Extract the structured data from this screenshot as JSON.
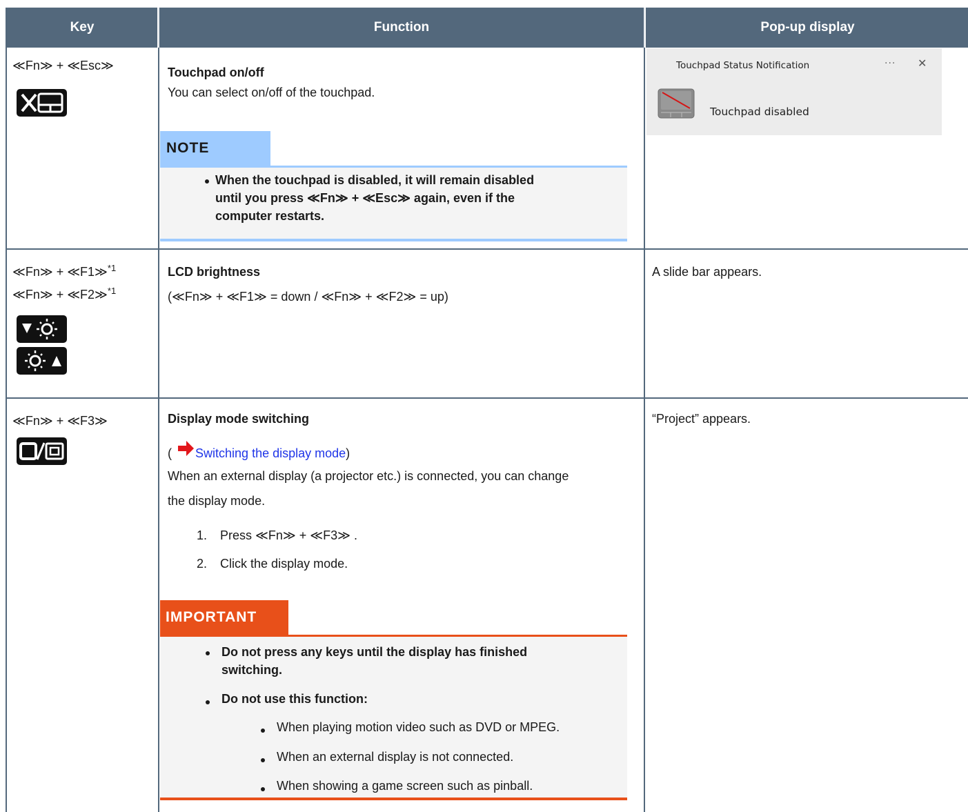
{
  "header": {
    "key": "Key",
    "function": "Function",
    "popup": "Pop-up display"
  },
  "row1": {
    "key": "≪Fn≫ + ≪Esc≫",
    "icon": "touchpad-off-icon",
    "title": "Touchpad on/off",
    "desc": "You can select on/off of the touchpad.",
    "note_label": "NOTE",
    "note_line1": "When the touchpad is disabled, it will remain disabled",
    "note_line2": "until you press ≪Fn≫ + ≪Esc≫ again, even if the",
    "note_line3": "computer restarts.",
    "popup_title": "Touchpad Status Notification",
    "popup_dots": "···",
    "popup_close": "✕",
    "popup_msg": "Touchpad disabled"
  },
  "row2": {
    "key1": "≪Fn≫ + ≪F1≫",
    "key2": "≪Fn≫ + ≪F2≫",
    "sup": "*1",
    "icon1": "brightness-down-icon",
    "icon2": "brightness-up-icon",
    "title": "LCD brightness",
    "desc": "(≪Fn≫ + ≪F1≫ = down / ≪Fn≫ + ≪F2≫ = up)",
    "popup": "A slide bar appears."
  },
  "row3": {
    "key": "≪Fn≫ + ≪F3≫",
    "icon": "display-switch-icon",
    "title": "Display mode switching",
    "link_open": "(",
    "link": "Switching the display mode",
    "link_close": ")",
    "desc1": "When an external display (a projector etc.) is connected, you can change",
    "desc2": "the display mode.",
    "step1_num": "1.",
    "step1": "Press ≪Fn≫ + ≪F3≫ .",
    "step2_num": "2.",
    "step2": "Click the display mode.",
    "imp_label": "IMPORTANT",
    "imp1a": "Do not press any keys until the display has finished",
    "imp1b": "switching.",
    "imp2": "Do not use this function:",
    "sub1": "When playing motion video such as DVD or MPEG.",
    "sub2": "When an external display is not connected.",
    "sub3": "When showing a game screen such as pinball.",
    "popup": "“Project” appears."
  },
  "colors": {
    "header_bg": "#53687c",
    "note_blue": "#9ecbff",
    "important_orange": "#e8501a",
    "link_blue": "#1f35e8"
  }
}
